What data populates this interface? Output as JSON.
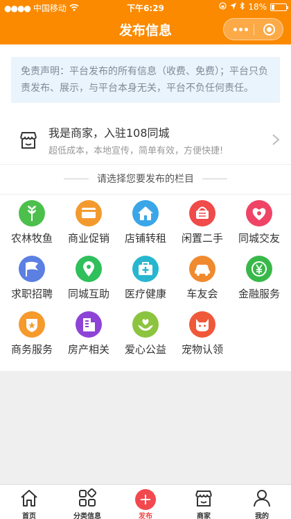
{
  "status_bar": {
    "carrier": "中国移动",
    "time": "下午6:29",
    "battery": "18%"
  },
  "nav": {
    "title": "发布信息"
  },
  "disclaimer": "免责声明：平台发布的所有信息（收费、免费）；平台只负责发布、展示，与平台本身无关，平台不负任何责任。",
  "merchant": {
    "title": "我是商家，入驻108同城",
    "subtitle": "超低成本，本地宣传，简单有效，方便快捷!"
  },
  "section_title": "请选择您要发布的栏目",
  "categories": [
    {
      "label": "农林牧鱼",
      "icon": "wheat-icon",
      "color": "#4cbf4c"
    },
    {
      "label": "商业促销",
      "icon": "card-icon",
      "color": "#f39a2e"
    },
    {
      "label": "店铺转租",
      "icon": "house-icon",
      "color": "#3aa6e8"
    },
    {
      "label": "闲置二手",
      "icon": "basket-icon",
      "color": "#f04a4a"
    },
    {
      "label": "同城交友",
      "icon": "heart-icon",
      "color": "#ef4466"
    },
    {
      "label": "求职招聘",
      "icon": "flag-icon",
      "color": "#5b7fe2"
    },
    {
      "label": "同城互助",
      "icon": "pin-icon",
      "color": "#2fbf5b"
    },
    {
      "label": "医疗健康",
      "icon": "medkit-icon",
      "color": "#27b6cf"
    },
    {
      "label": "车友会",
      "icon": "car-icon",
      "color": "#f08a2e"
    },
    {
      "label": "金融服务",
      "icon": "yen-icon",
      "color": "#39b84a"
    },
    {
      "label": "商务服务",
      "icon": "badge-icon",
      "color": "#f59a2b"
    },
    {
      "label": "房产相关",
      "icon": "building-icon",
      "color": "#8d44d6"
    },
    {
      "label": "爱心公益",
      "icon": "hands-icon",
      "color": "#8cc43f"
    },
    {
      "label": "宠物认领",
      "icon": "cat-icon",
      "color": "#f0583a"
    }
  ],
  "tabs": [
    {
      "label": "首页",
      "icon": "home-icon"
    },
    {
      "label": "分类信息",
      "icon": "grid-icon"
    },
    {
      "label": "发布",
      "icon": "plus-icon"
    },
    {
      "label": "商家",
      "icon": "shop-icon"
    },
    {
      "label": "我的",
      "icon": "user-icon"
    }
  ],
  "colors": {
    "brand": "#fb8a00",
    "accent": "#f04444"
  }
}
